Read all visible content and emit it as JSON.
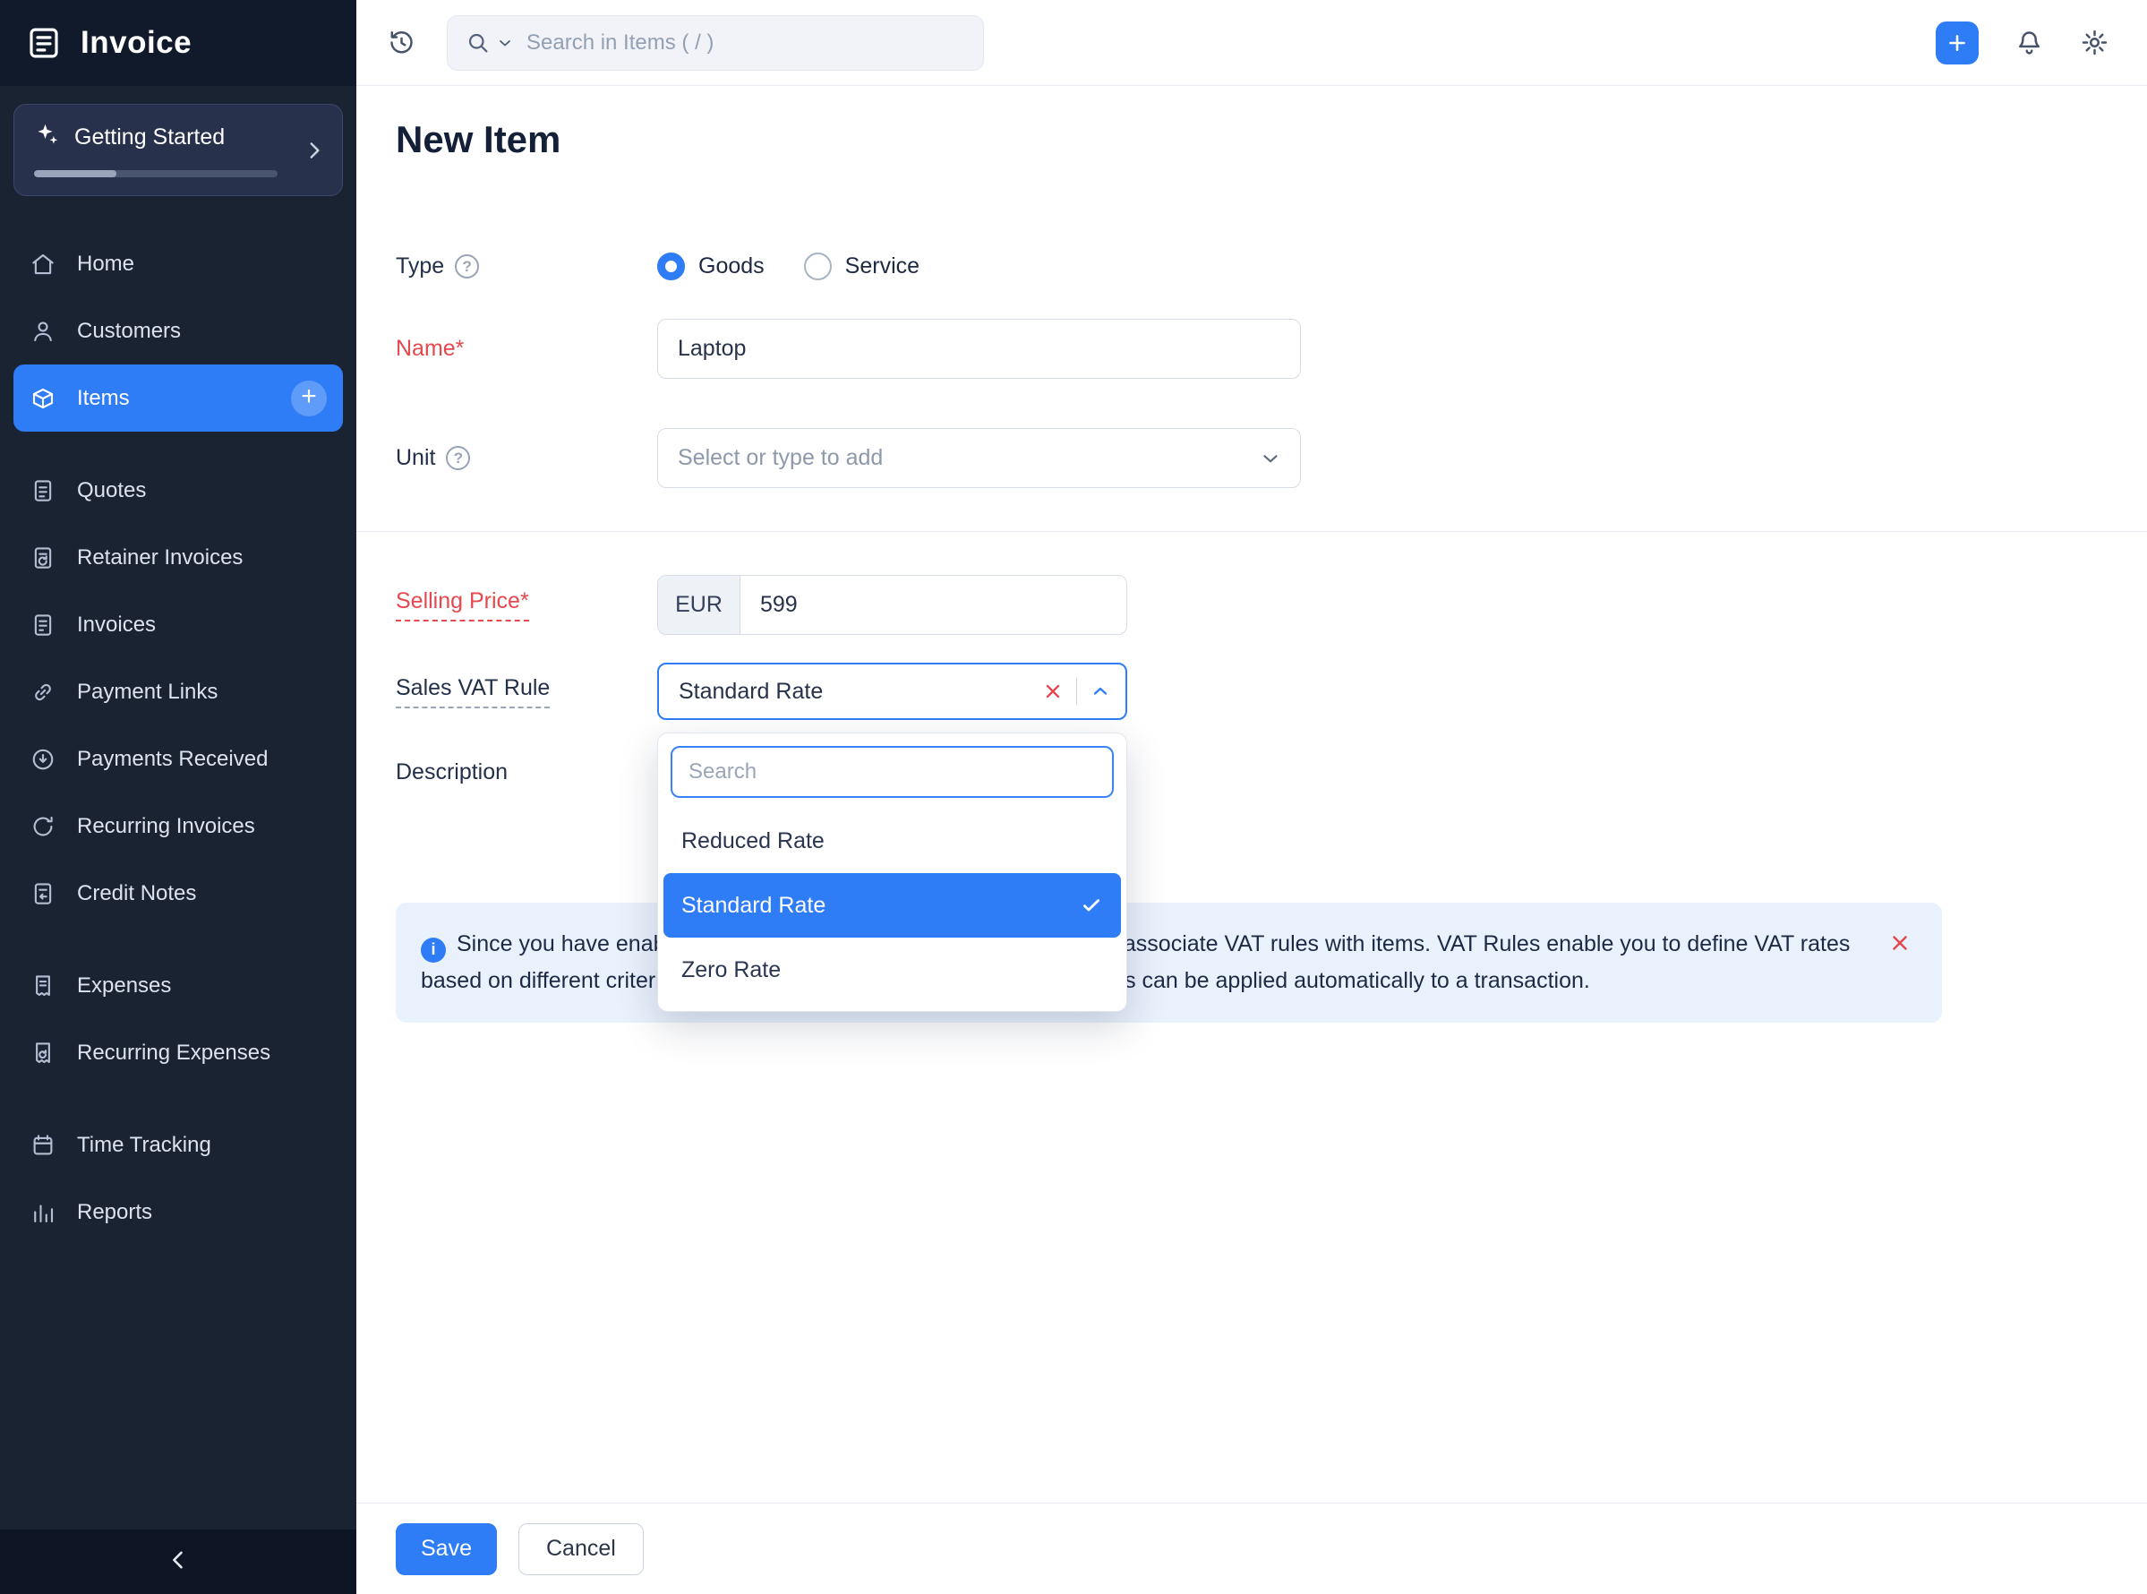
{
  "app": {
    "name": "Invoice"
  },
  "sidebar": {
    "getting_started": {
      "label": "Getting Started"
    },
    "groups": [
      {
        "items": [
          {
            "label": "Home",
            "icon": "home"
          },
          {
            "label": "Customers",
            "icon": "customers"
          },
          {
            "label": "Items",
            "icon": "items",
            "active": true,
            "has_add": true
          }
        ]
      },
      {
        "items": [
          {
            "label": "Quotes",
            "icon": "quotes"
          },
          {
            "label": "Retainer Invoices",
            "icon": "retainer-invoices"
          },
          {
            "label": "Invoices",
            "icon": "invoices"
          },
          {
            "label": "Payment Links",
            "icon": "payment-links"
          },
          {
            "label": "Payments Received",
            "icon": "payments-received"
          },
          {
            "label": "Recurring Invoices",
            "icon": "recurring-invoices"
          },
          {
            "label": "Credit Notes",
            "icon": "credit-notes"
          }
        ]
      },
      {
        "items": [
          {
            "label": "Expenses",
            "icon": "expenses"
          },
          {
            "label": "Recurring Expenses",
            "icon": "recurring-expenses"
          }
        ]
      },
      {
        "items": [
          {
            "label": "Time Tracking",
            "icon": "time-tracking"
          },
          {
            "label": "Reports",
            "icon": "reports"
          }
        ]
      }
    ]
  },
  "topbar": {
    "search_placeholder": "Search in Items ( / )"
  },
  "page": {
    "title": "New Item"
  },
  "form": {
    "type": {
      "label": "Type",
      "options": [
        {
          "label": "Goods",
          "selected": true
        },
        {
          "label": "Service",
          "selected": false
        }
      ]
    },
    "name": {
      "label": "Name*",
      "value": "Laptop"
    },
    "unit": {
      "label": "Unit",
      "placeholder": "Select or type to add"
    },
    "selling_price": {
      "label": "Selling Price*",
      "currency": "EUR",
      "value": "599"
    },
    "sales_vat_rule": {
      "label": "Sales VAT Rule",
      "value": "Standard Rate"
    },
    "description": {
      "label": "Description"
    }
  },
  "vat_dropdown": {
    "search_placeholder": "Search",
    "options": [
      {
        "label": "Reduced Rate",
        "selected": false
      },
      {
        "label": "Standard Rate",
        "selected": true
      },
      {
        "label": "Zero Rate",
        "selected": false
      }
    ]
  },
  "banner": {
    "text": "Since you have enabled VAT for your organisation, you will have to associate VAT rules with items. VAT Rules enable you to define VAT rates based on different criteria and associate it with an item so that VAT rates can be applied automatically to a transaction."
  },
  "footer": {
    "save_label": "Save",
    "cancel_label": "Cancel"
  },
  "colors": {
    "accent": "#2e7cf6",
    "danger": "#e5484d",
    "sidebar_bg": "#1a2332",
    "banner_bg": "#e9f1fc"
  }
}
